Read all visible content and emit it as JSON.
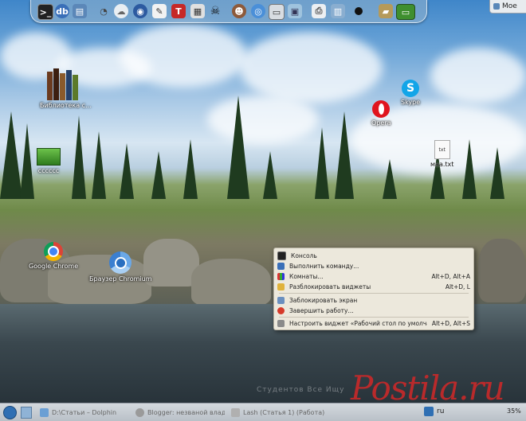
{
  "dock": {
    "icons": [
      "terminal-icon",
      "database-icon",
      "document-stack-icon",
      "satellite-dish-icon",
      "weather-cloud-icon",
      "circular-app-icon",
      "edit-pencil-icon",
      "tor-icon",
      "calculator-icon",
      "skull-icon",
      "avatar-icon",
      "chromium-icon",
      "window-settings-icon",
      "photo-icon",
      "printer-icon",
      "cabinet-icon",
      "media-dot-icon",
      "folder-icon",
      "green-window-icon"
    ]
  },
  "top_right": {
    "label": "Мое"
  },
  "desktop_icons": {
    "library": "Библиотека с...",
    "green_folder": "cccccc",
    "chrome": "Google Chrome",
    "chromium": "Браузер Chromium",
    "skype": "Skype",
    "opera": "Opera",
    "text_file": "маа.txt",
    "text_file_badge": "txt"
  },
  "context_menu": {
    "items": [
      {
        "label": "Консоль",
        "shortcut": ""
      },
      {
        "label": "Выполнить команду...",
        "shortcut": ""
      },
      {
        "label": "Комнаты...",
        "shortcut": "Alt+D, Alt+A"
      },
      {
        "label": "Разблокировать виджеты",
        "shortcut": "Alt+D, L"
      },
      {
        "label": "Заблокировать экран",
        "shortcut": ""
      },
      {
        "label": "Завершить работу...",
        "shortcut": ""
      },
      {
        "label": "Настроить виджет «Рабочий стол по умолчанию»",
        "shortcut": "Alt+D, Alt+S"
      }
    ]
  },
  "watermark": {
    "main": "Postila.ru",
    "faint": "Студентов Все Ищу"
  },
  "taskbar": {
    "tasks": [
      "D:\\Статьи – Dolphin",
      "Blogger: незваной влад",
      "Lash (Статья 1) (Работа)"
    ],
    "lang": "ru",
    "battery": "35%"
  },
  "colors": {
    "menu_bg": "#ece8dc",
    "watermark": "#d22828",
    "taskbar": "#c8ced4"
  }
}
